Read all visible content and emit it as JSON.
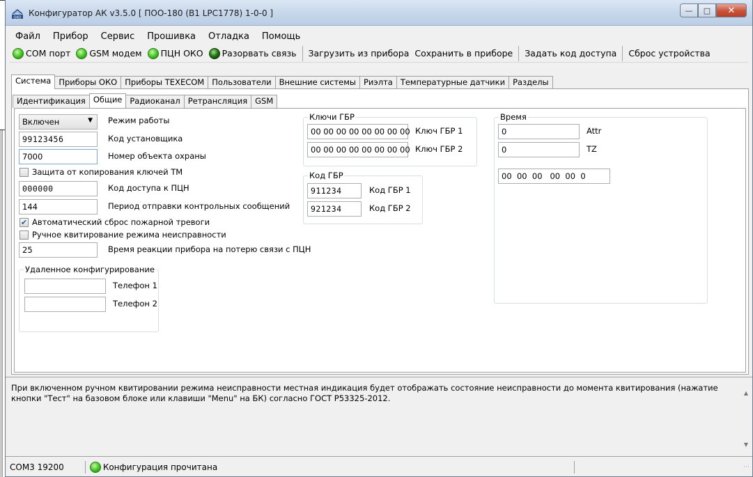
{
  "window": {
    "title": "Конфигуратор АК v3.5.0 [ ПОО-180 (В1 LPC1778) 1-0-0 ]",
    "app_icon": "oko-logo-icon",
    "controls": [
      "minimize-icon",
      "maximize-icon",
      "close-icon"
    ]
  },
  "menu": [
    "Файл",
    "Прибор",
    "Сервис",
    "Прошивка",
    "Отладка",
    "Помощь"
  ],
  "toolbar": {
    "com_port": "COM порт",
    "gsm_modem": "GSM модем",
    "pcn_oko": "ПЦН ОКО",
    "disconnect": "Разорвать связь",
    "load_from_device": "Загрузить из прибора",
    "save_to_device": "Сохранить в приборе",
    "set_access_code": "Задать код доступа",
    "reset_device": "Сброс устройства"
  },
  "main_tabs": [
    "Система",
    "Приборы ОКО",
    "Приборы TEXECOM",
    "Пользователи",
    "Внешние системы",
    "Риэлта",
    "Температурные датчики",
    "Разделы"
  ],
  "sub_tabs": [
    "Идентификация",
    "Общие",
    "Радиоканал",
    "Ретрансляция",
    "GSM"
  ],
  "general": {
    "mode_value": "Включен",
    "mode_label": "Режим работы",
    "installer_code_value": "99123456",
    "installer_code_label": "Код установщика",
    "object_number_value": "7000",
    "object_number_label": "Номер объекта охраны",
    "tm_copy_protect_label": "Защита от копирования ключей ТМ",
    "tm_copy_protect_checked": false,
    "pcn_access_code_value": "000000",
    "pcn_access_code_label": "Код доступа к ПЦН",
    "control_period_value": "144",
    "control_period_label": "Период отправки контрольных сообщений",
    "auto_fire_reset_label": "Автоматический сброс пожарной тревоги",
    "auto_fire_reset_checked": true,
    "manual_fault_ack_label": "Ручное квитирование режима неисправности",
    "manual_fault_ack_checked": false,
    "reaction_time_value": "25",
    "reaction_time_label": "Время реакции прибора на потерю связи с ПЦН"
  },
  "remote_config": {
    "title": "Удаленное конфигурирование",
    "phone1_value": "",
    "phone1_label": "Телефон 1",
    "phone2_value": "",
    "phone2_label": "Телефон 2"
  },
  "gbr_keys": {
    "title": "Ключи ГБР",
    "key1_value": "00 00 00 00 00 00 00 00",
    "key1_label": "Ключ ГБР 1",
    "key2_value": "00 00 00 00 00 00 00 00",
    "key2_label": "Ключ ГБР 2"
  },
  "gbr_codes": {
    "title": "Код ГБР",
    "code1_value": "911234",
    "code1_label": "Код ГБР 1",
    "code2_value": "921234",
    "code2_label": "Код ГБР 2"
  },
  "time": {
    "title": "Время",
    "attr_value": "0",
    "attr_label": "Attr",
    "tz_value": "0",
    "tz_label": "TZ",
    "clock_value": "00  00  00   00  00  0"
  },
  "info_text": "При включенном ручном квитировании режима неисправности местная индикация будет отображать состояние неисправности до момента квитирования (нажатие кнопки \"Тест\" на базовом блоке или клавиши \"Menu\" на БК) согласно ГОСТ Р53325-2012.",
  "status": {
    "port": "COM3 19200",
    "message": "Конфигурация прочитана"
  },
  "colors": {
    "led_green": "#3fc11f",
    "titlebar": "#c4d5ea",
    "close_button": "#c8513a"
  }
}
